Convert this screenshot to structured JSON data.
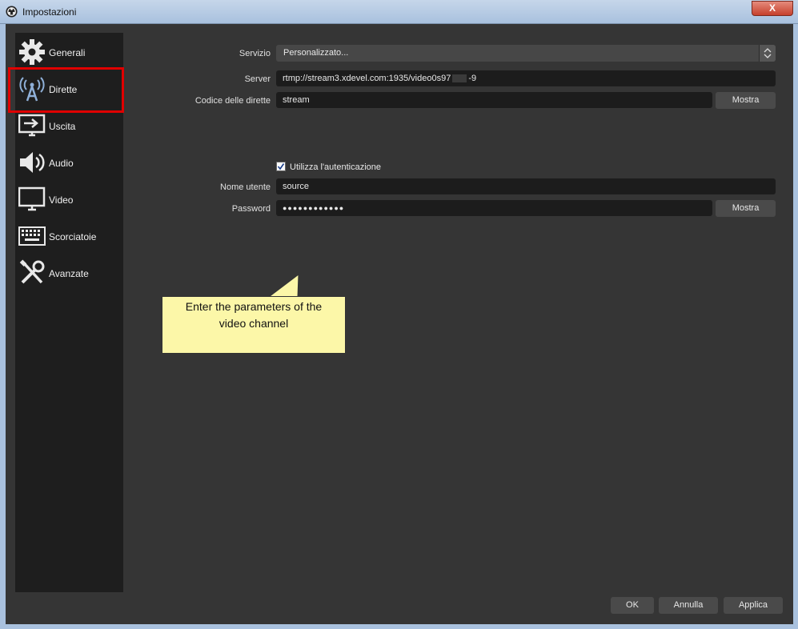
{
  "window": {
    "title": "Impostazioni",
    "close_label": "X"
  },
  "sidebar": {
    "items": [
      {
        "label": "Generali",
        "icon": "gear-icon"
      },
      {
        "label": "Dirette",
        "icon": "broadcast-antenna-icon",
        "selected": true
      },
      {
        "label": "Uscita",
        "icon": "output-monitor-icon"
      },
      {
        "label": "Audio",
        "icon": "speaker-icon"
      },
      {
        "label": "Video",
        "icon": "monitor-icon"
      },
      {
        "label": "Scorciatoie",
        "icon": "keyboard-icon"
      },
      {
        "label": "Avanzate",
        "icon": "tools-icon"
      }
    ]
  },
  "stream": {
    "service_label": "Servizio",
    "service_value": "Personalizzato...",
    "server_label": "Server",
    "server_value": "rtmp://stream3.xdevel.com:1935/video0s97",
    "server_suffix": "-9",
    "key_label": "Codice delle dirette",
    "key_value": "stream",
    "show_label": "Mostra",
    "auth_label": "Utilizza l'autenticazione",
    "auth_checked": true,
    "user_label": "Nome utente",
    "user_value": "source",
    "password_label": "Password",
    "password_value": "●●●●●●●●●●●●"
  },
  "callout": {
    "line1": "Enter the parameters of the",
    "line2": "video channel"
  },
  "buttons": {
    "ok": "OK",
    "cancel": "Annulla",
    "apply": "Applica"
  },
  "colors": {
    "highlight": "#e00000",
    "callout": "#fcf7a8"
  }
}
